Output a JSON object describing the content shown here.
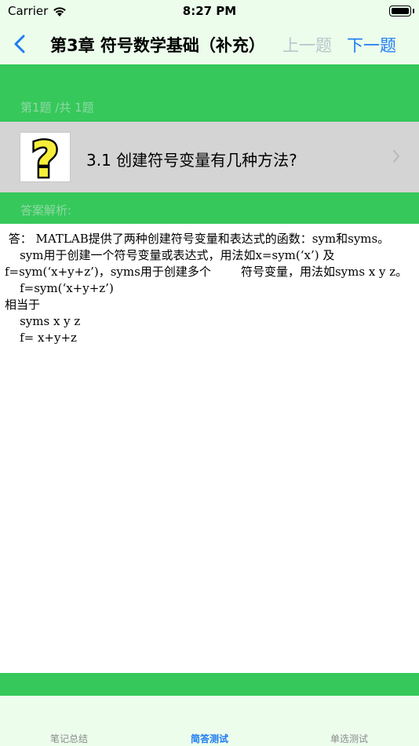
{
  "status_bar": {
    "carrier": "Carrier",
    "time": "8:27 PM"
  },
  "nav": {
    "title": "第3章 符号数学基础（补充）",
    "prev_label": "上一题",
    "next_label": "下一题"
  },
  "quiz": {
    "counter": "第1题 /共 1题",
    "question": "3.1 创建符号变量有几种方法?",
    "answer_label": "答案解析:",
    "answer_lines": [
      " 答： MATLAB提供了两种创建符号变量和表达式的函数：sym和syms。",
      "    sym用于创建一个符号变量或表达式，用法如x=sym(‘x’) 及 f=sym(‘x+y+z’)，syms用于创建多个        符号变量，用法如syms x y z。",
      "    f=sym(‘x+y+z’)",
      "相当于",
      "    syms x y z",
      "    f= x+y+z"
    ]
  },
  "tabs": {
    "notes": "笔记总结",
    "short_answer": "简答测试",
    "single_choice": "单选测试"
  },
  "colors": {
    "accent_green": "#36c85b",
    "tint_blue": "#1e7cf2",
    "bar_bg": "#ecfdec",
    "question_bg": "#d4d4d4"
  }
}
